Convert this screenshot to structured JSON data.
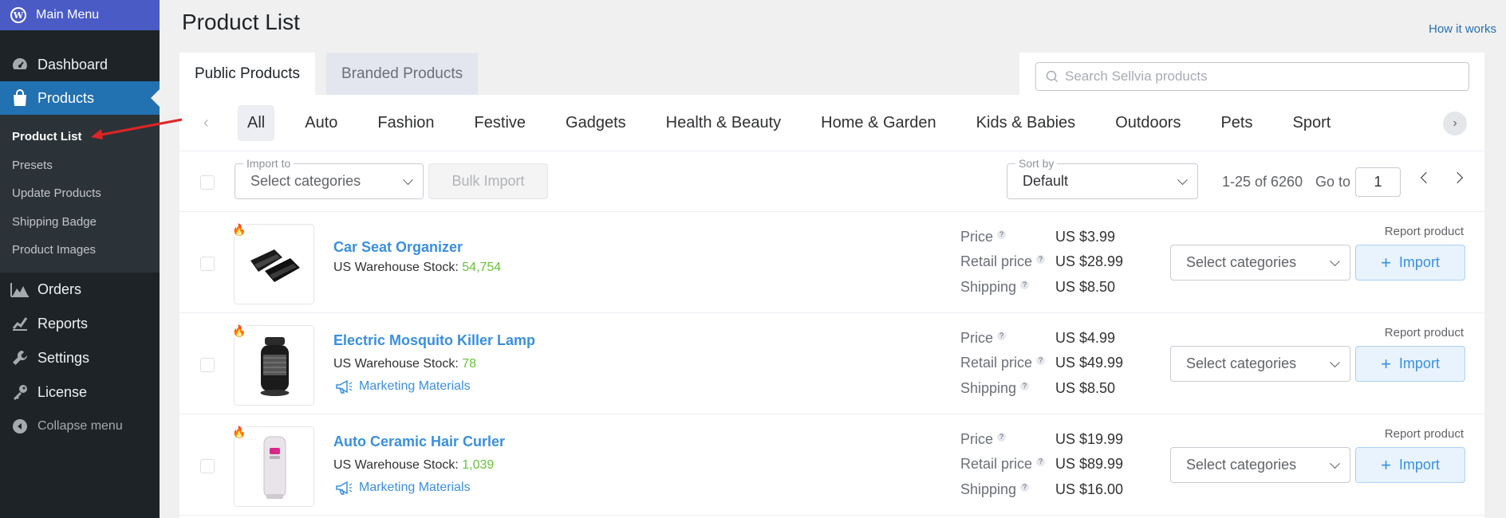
{
  "sidebar": {
    "top_label": "Main Menu",
    "menu": [
      {
        "label": "Dashboard",
        "icon": "dashboard-icon"
      },
      {
        "label": "Products",
        "icon": "shopping-bag-icon",
        "active": true
      }
    ],
    "submenu": [
      "Product List",
      "Presets",
      "Update Products",
      "Shipping Badge",
      "Product Images"
    ],
    "menu_after": [
      {
        "label": "Orders",
        "icon": "chart-area-icon"
      },
      {
        "label": "Reports",
        "icon": "chart-line-icon"
      },
      {
        "label": "Settings",
        "icon": "wrench-icon"
      },
      {
        "label": "License",
        "icon": "key-icon"
      },
      {
        "label": "Collapse menu",
        "icon": "collapse-icon"
      }
    ]
  },
  "header": {
    "title": "Product List",
    "help_link": "How it works"
  },
  "tabs": [
    "Public Products",
    "Branded Products"
  ],
  "search": {
    "placeholder": "Search Sellvia products"
  },
  "categories": [
    "All",
    "Auto",
    "Fashion",
    "Festive",
    "Gadgets",
    "Health & Beauty",
    "Home & Garden",
    "Kids & Babies",
    "Outdoors",
    "Pets",
    "Sport"
  ],
  "toolbar": {
    "import_label": "Import to",
    "import_placeholder": "Select categories",
    "bulk_import": "Bulk Import",
    "sort_label": "Sort by",
    "sort_value": "Default",
    "range": "1-25 of 6260",
    "goto_label": "Go to",
    "goto_value": "1"
  },
  "row_labels": {
    "stock": "US Warehouse Stock:",
    "price": "Price",
    "retail": "Retail price",
    "shipping": "Shipping",
    "report": "Report product",
    "select": "Select categories",
    "import": "Import",
    "marketing": "Marketing Materials"
  },
  "products": [
    {
      "name": "Car Seat Organizer",
      "stock": "54,754",
      "price": "US $3.99",
      "retail": "US $28.99",
      "shipping": "US $8.50",
      "marketing": false
    },
    {
      "name": "Electric Mosquito Killer Lamp",
      "stock": "78",
      "price": "US $4.99",
      "retail": "US $49.99",
      "shipping": "US $8.50",
      "marketing": true
    },
    {
      "name": "Auto Ceramic Hair Curler",
      "stock": "1,039",
      "price": "US $19.99",
      "retail": "US $89.99",
      "shipping": "US $16.00",
      "marketing": true
    }
  ],
  "colors": {
    "accent": "#2271b1",
    "link": "#3a8fdc",
    "stock": "#67c23a",
    "sidebar": "#1d2327",
    "annotation": "#e02424"
  }
}
